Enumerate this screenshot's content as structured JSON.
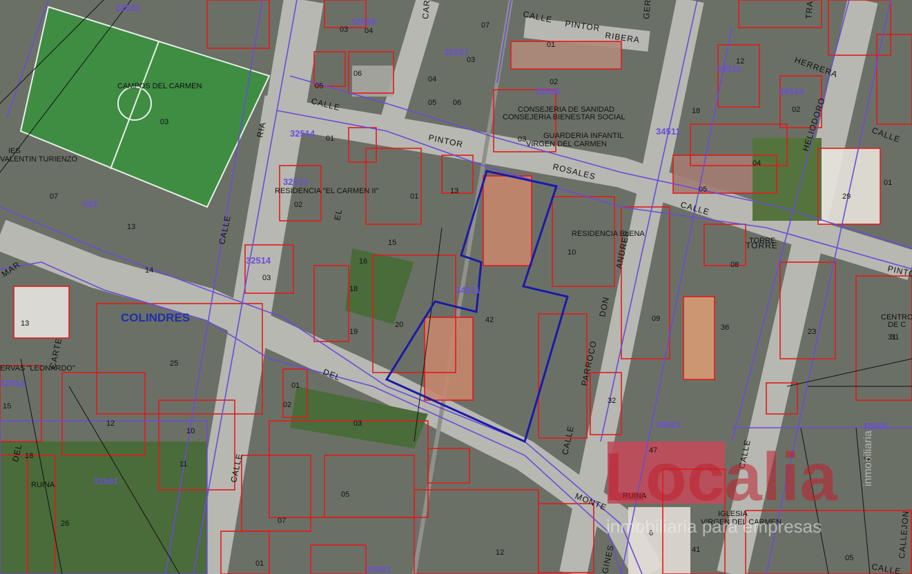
{
  "town": "COLINDRES",
  "watermark": {
    "brand": "Localia",
    "tag": "inmobiliaria",
    "slogan": "inmobiliaria para empresas"
  },
  "places": {
    "campos": "CAMPOS DEL CARMEN",
    "ies": "IES",
    "ies2": "VALENTIN TURIENZO",
    "residencia_carmen": "RESIDENCIA \"EL CARMEN II\"",
    "residencia_elena": "RESIDENCIA ELENA",
    "consejeria": "CONSEJERIA DE SANIDAD",
    "consejeria2": "CONSEJERIA BIENESTAR SOCIAL",
    "guarderia": "GUARDERIA INFANTIL",
    "guarderia2": "VIRGEN DEL CARMEN",
    "iglesia": "IGLESIA",
    "iglesia2": "VIRGEN DEL CARMEN",
    "ruina": "RUINA",
    "ruina2": "RUINA",
    "conservas": "ERVAS \"LEONARDO\"",
    "centro": "CENTRO",
    "centro2": "DE C",
    "torre": "TORRE"
  },
  "streets": [
    "CALLE",
    "PINTOR",
    "RIBERA",
    "CALLE",
    "PINTOR",
    "ROSALES",
    "CALLE",
    "RIA",
    "CALLE",
    "EL",
    "DEL",
    "CALLE",
    "CALLE",
    "MONTE",
    "GINES",
    "DON",
    "ANDRES",
    "PARROCO",
    "CALLE",
    "HERRERA",
    "HELIODORO",
    "CALLE",
    "CALLE",
    "TORRE",
    "PINTO",
    "MAR",
    "CARTE",
    "DEL",
    "CALLEJON",
    "GER",
    "CAR",
    "TRA"
  ],
  "zones": [
    "32531",
    "32526",
    "32527",
    "33526",
    "32514",
    "34511",
    "34511",
    "34514",
    "32513",
    "34511",
    "32514",
    "32514",
    "34521",
    "31501",
    "33501",
    "35505",
    "001",
    "31"
  ],
  "parcels": [
    "03",
    "04",
    "07",
    "01",
    "03",
    "06",
    "05",
    "04",
    "05",
    "06",
    "02",
    "03",
    "01",
    "02",
    "03",
    "01",
    "07",
    "13",
    "18",
    "12",
    "02",
    "03",
    "15",
    "16",
    "18",
    "19",
    "20",
    "42",
    "10",
    "09",
    "08",
    "36",
    "05",
    "04",
    "01",
    "29",
    "23",
    "31",
    "32",
    "47",
    "6",
    "41",
    "12",
    "05",
    "07",
    "03",
    "01",
    "02",
    "25",
    "12",
    "10",
    "11",
    "18",
    "26",
    "15",
    "13",
    "14",
    "13",
    "01",
    "03",
    "02",
    "08",
    "01",
    "18",
    "05"
  ],
  "selected_parcel": "42"
}
